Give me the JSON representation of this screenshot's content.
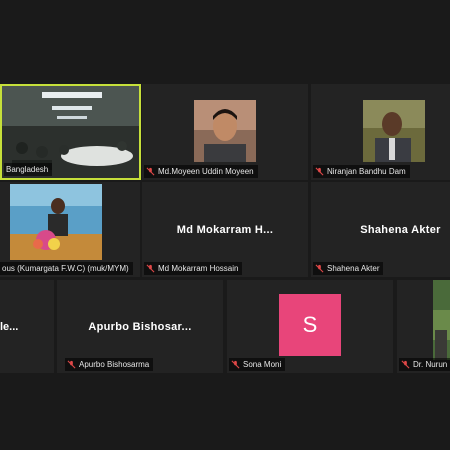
{
  "participants": {
    "p1": {
      "label": "Bangladesh"
    },
    "p2": {
      "label": "Md.Moyeen Uddin Moyeen"
    },
    "p3": {
      "label": "Niranjan Bandhu Dam"
    },
    "p4": {
      "label": "ous (Kumargata F.W.C) (muk/MYM)"
    },
    "p5": {
      "display_name": "Md  Mokarram  H...",
      "label": "Md Mokarram Hossain"
    },
    "p6": {
      "display_name": "Shahena Akter",
      "label": "Shahena Akter"
    },
    "p7": {
      "display_name": "le..."
    },
    "p8": {
      "display_name": "Apurbo  Bishosar...",
      "label": "Apurbo Bishosarma"
    },
    "p9": {
      "avatar_letter": "S",
      "label": "Sona Moni"
    },
    "p10": {
      "label": "Dr. Nurun"
    }
  },
  "colors": {
    "active_border": "#c6e03a",
    "avatar_bg": "#e8457a",
    "muted_mic": "#e04848"
  }
}
